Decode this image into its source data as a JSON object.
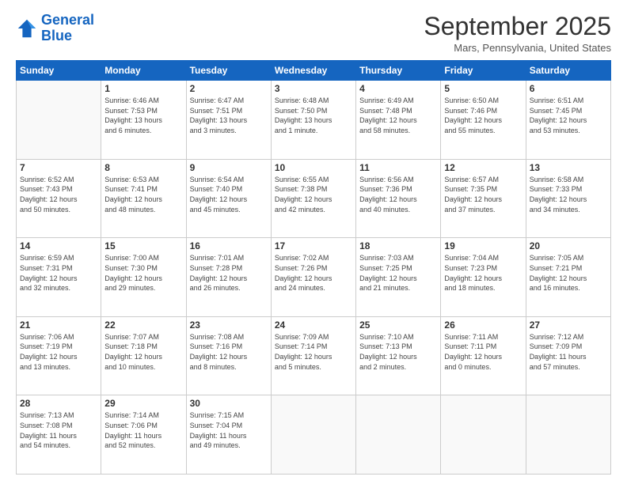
{
  "logo": {
    "line1": "General",
    "line2": "Blue"
  },
  "header": {
    "title": "September 2025",
    "location": "Mars, Pennsylvania, United States"
  },
  "weekdays": [
    "Sunday",
    "Monday",
    "Tuesday",
    "Wednesday",
    "Thursday",
    "Friday",
    "Saturday"
  ],
  "weeks": [
    [
      {
        "day": "",
        "info": ""
      },
      {
        "day": "1",
        "info": "Sunrise: 6:46 AM\nSunset: 7:53 PM\nDaylight: 13 hours\nand 6 minutes."
      },
      {
        "day": "2",
        "info": "Sunrise: 6:47 AM\nSunset: 7:51 PM\nDaylight: 13 hours\nand 3 minutes."
      },
      {
        "day": "3",
        "info": "Sunrise: 6:48 AM\nSunset: 7:50 PM\nDaylight: 13 hours\nand 1 minute."
      },
      {
        "day": "4",
        "info": "Sunrise: 6:49 AM\nSunset: 7:48 PM\nDaylight: 12 hours\nand 58 minutes."
      },
      {
        "day": "5",
        "info": "Sunrise: 6:50 AM\nSunset: 7:46 PM\nDaylight: 12 hours\nand 55 minutes."
      },
      {
        "day": "6",
        "info": "Sunrise: 6:51 AM\nSunset: 7:45 PM\nDaylight: 12 hours\nand 53 minutes."
      }
    ],
    [
      {
        "day": "7",
        "info": "Sunrise: 6:52 AM\nSunset: 7:43 PM\nDaylight: 12 hours\nand 50 minutes."
      },
      {
        "day": "8",
        "info": "Sunrise: 6:53 AM\nSunset: 7:41 PM\nDaylight: 12 hours\nand 48 minutes."
      },
      {
        "day": "9",
        "info": "Sunrise: 6:54 AM\nSunset: 7:40 PM\nDaylight: 12 hours\nand 45 minutes."
      },
      {
        "day": "10",
        "info": "Sunrise: 6:55 AM\nSunset: 7:38 PM\nDaylight: 12 hours\nand 42 minutes."
      },
      {
        "day": "11",
        "info": "Sunrise: 6:56 AM\nSunset: 7:36 PM\nDaylight: 12 hours\nand 40 minutes."
      },
      {
        "day": "12",
        "info": "Sunrise: 6:57 AM\nSunset: 7:35 PM\nDaylight: 12 hours\nand 37 minutes."
      },
      {
        "day": "13",
        "info": "Sunrise: 6:58 AM\nSunset: 7:33 PM\nDaylight: 12 hours\nand 34 minutes."
      }
    ],
    [
      {
        "day": "14",
        "info": "Sunrise: 6:59 AM\nSunset: 7:31 PM\nDaylight: 12 hours\nand 32 minutes."
      },
      {
        "day": "15",
        "info": "Sunrise: 7:00 AM\nSunset: 7:30 PM\nDaylight: 12 hours\nand 29 minutes."
      },
      {
        "day": "16",
        "info": "Sunrise: 7:01 AM\nSunset: 7:28 PM\nDaylight: 12 hours\nand 26 minutes."
      },
      {
        "day": "17",
        "info": "Sunrise: 7:02 AM\nSunset: 7:26 PM\nDaylight: 12 hours\nand 24 minutes."
      },
      {
        "day": "18",
        "info": "Sunrise: 7:03 AM\nSunset: 7:25 PM\nDaylight: 12 hours\nand 21 minutes."
      },
      {
        "day": "19",
        "info": "Sunrise: 7:04 AM\nSunset: 7:23 PM\nDaylight: 12 hours\nand 18 minutes."
      },
      {
        "day": "20",
        "info": "Sunrise: 7:05 AM\nSunset: 7:21 PM\nDaylight: 12 hours\nand 16 minutes."
      }
    ],
    [
      {
        "day": "21",
        "info": "Sunrise: 7:06 AM\nSunset: 7:19 PM\nDaylight: 12 hours\nand 13 minutes."
      },
      {
        "day": "22",
        "info": "Sunrise: 7:07 AM\nSunset: 7:18 PM\nDaylight: 12 hours\nand 10 minutes."
      },
      {
        "day": "23",
        "info": "Sunrise: 7:08 AM\nSunset: 7:16 PM\nDaylight: 12 hours\nand 8 minutes."
      },
      {
        "day": "24",
        "info": "Sunrise: 7:09 AM\nSunset: 7:14 PM\nDaylight: 12 hours\nand 5 minutes."
      },
      {
        "day": "25",
        "info": "Sunrise: 7:10 AM\nSunset: 7:13 PM\nDaylight: 12 hours\nand 2 minutes."
      },
      {
        "day": "26",
        "info": "Sunrise: 7:11 AM\nSunset: 7:11 PM\nDaylight: 12 hours\nand 0 minutes."
      },
      {
        "day": "27",
        "info": "Sunrise: 7:12 AM\nSunset: 7:09 PM\nDaylight: 11 hours\nand 57 minutes."
      }
    ],
    [
      {
        "day": "28",
        "info": "Sunrise: 7:13 AM\nSunset: 7:08 PM\nDaylight: 11 hours\nand 54 minutes."
      },
      {
        "day": "29",
        "info": "Sunrise: 7:14 AM\nSunset: 7:06 PM\nDaylight: 11 hours\nand 52 minutes."
      },
      {
        "day": "30",
        "info": "Sunrise: 7:15 AM\nSunset: 7:04 PM\nDaylight: 11 hours\nand 49 minutes."
      },
      {
        "day": "",
        "info": ""
      },
      {
        "day": "",
        "info": ""
      },
      {
        "day": "",
        "info": ""
      },
      {
        "day": "",
        "info": ""
      }
    ]
  ]
}
